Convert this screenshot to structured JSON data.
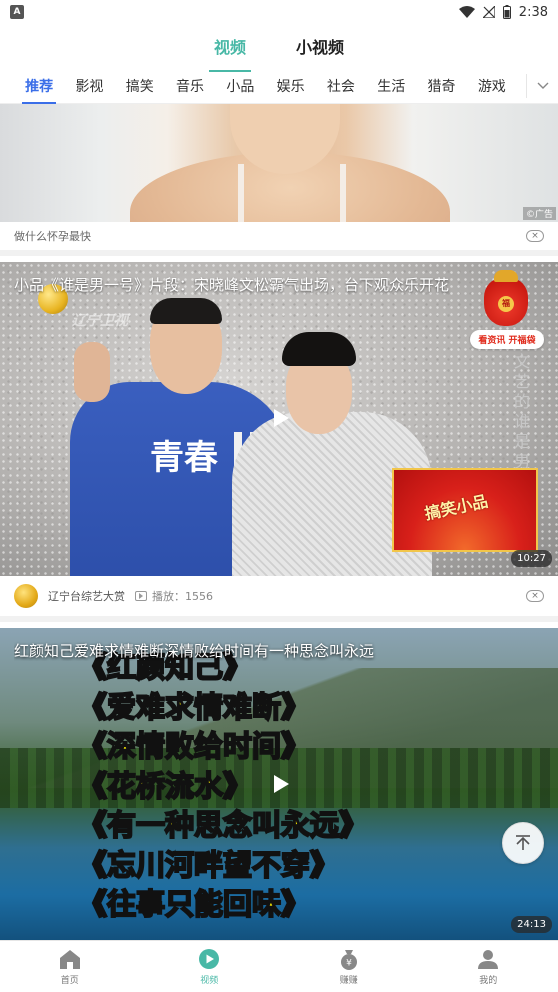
{
  "status_bar": {
    "time": "2:38",
    "app_badge": "A"
  },
  "top_tabs": [
    {
      "label": "视频",
      "active": true
    },
    {
      "label": "小视频",
      "active": false
    }
  ],
  "categories": [
    {
      "label": "推荐",
      "active": true
    },
    {
      "label": "影视"
    },
    {
      "label": "搞笑"
    },
    {
      "label": "音乐"
    },
    {
      "label": "小品"
    },
    {
      "label": "娱乐"
    },
    {
      "label": "社会"
    },
    {
      "label": "生活"
    },
    {
      "label": "猎奇"
    },
    {
      "label": "游戏"
    }
  ],
  "ad": {
    "caption": "做什么怀孕最快",
    "source_mark": "©广告",
    "close_glyph": "×"
  },
  "video1": {
    "title": "小品《谁是男一号》片段：宋晓峰文松霸气出场，台下观众乐开花",
    "duration": "10:27",
    "channel": "辽宁台综艺大赏",
    "play_count_label": "播放：1556",
    "close_glyph": "×",
    "overlay_text_shirt": "青春",
    "overlay_text_fan": "搞笑小品",
    "overlay_text_side": "文艺的谁是男一号",
    "overlay_logo": "辽宁卫视"
  },
  "lucky_bag": {
    "label": "看资讯 开福袋",
    "coin_text": "福"
  },
  "video2": {
    "title": "红颜知己爱难求情难断深情败给时间有一种思念叫永远",
    "duration": "24:13",
    "poem_lines": [
      "《红颜知己》",
      "《爱难求情难断》",
      "《深情败给时间》",
      "《花桥流水》",
      "《有一种思念叫永远》",
      "《忘川河畔望不穿》",
      "《往事只能回味》"
    ]
  },
  "bottom_nav": [
    {
      "label": "首页",
      "icon": "home-icon",
      "active": false
    },
    {
      "label": "视频",
      "icon": "video-play-icon",
      "active": true
    },
    {
      "label": "赚赚",
      "icon": "money-bag-icon",
      "active": false
    },
    {
      "label": "我的",
      "icon": "person-icon",
      "active": false
    }
  ],
  "colors": {
    "accent": "#48b8a6",
    "category_active": "#3a6ee8",
    "poem_text": "#fff200",
    "lucky_bag_red": "#e02a1b"
  }
}
